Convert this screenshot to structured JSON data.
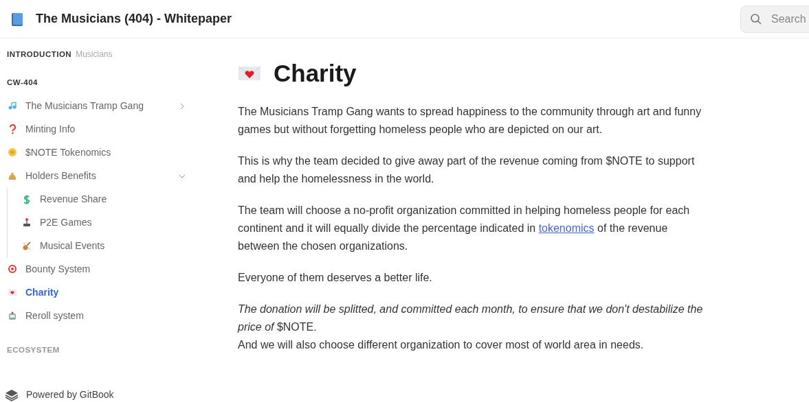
{
  "header": {
    "title": "The Musicians (404) - Whitepaper",
    "search": {
      "placeholder": "Search"
    }
  },
  "sidebar": {
    "sections": [
      {
        "heading": "INTRODUCTION",
        "faded_text": "Musicians"
      },
      {
        "heading": "CW-404",
        "items": [
          {
            "label": "The Musicians Tramp Gang",
            "selected": false,
            "expandable": true,
            "expanded": false
          },
          {
            "label": "Minting Info",
            "selected": false
          },
          {
            "label": "$NOTE Tokenomics",
            "selected": false
          },
          {
            "label": "Holders Benefits",
            "selected": false,
            "expandable": true,
            "expanded": true,
            "children": [
              {
                "label": "Revenue Share",
                "selected": false
              },
              {
                "label": "P2E Games",
                "selected": false
              },
              {
                "label": "Musical Events",
                "selected": false
              }
            ]
          },
          {
            "label": "Bounty System",
            "selected": false
          },
          {
            "label": "Charity",
            "selected": true
          },
          {
            "label": "Reroll system",
            "selected": false
          }
        ]
      },
      {
        "heading": "ECOSYSTEM"
      }
    ],
    "footer": "Powered by GitBook"
  },
  "page": {
    "title": "Charity",
    "blocks": [
      {
        "kind": "text",
        "text": "The Musicians Tramp Gang wants to spread happiness to the community through art and funny games but without forgetting homeless people who are depicted on our art."
      },
      {
        "kind": "text",
        "text": "This is why the team decided to give away part of the revenue coming from $NOTE to support and help the homelessness in the world."
      },
      {
        "kind": "linked",
        "before": "The team will choose a no-profit organization committed in helping homeless people for each continent and it will equally divide the percentage indicated in",
        "link": "tokenomics",
        "after": "of the revenue between the chosen organizations."
      },
      {
        "kind": "text",
        "text": "Everyone of them deserves a better life."
      },
      {
        "kind": "lines",
        "lines": [
          "*The donation will be splitted, and committed each month, to ensure that we don't destabilize the price of* $NOTE.",
          "And we will also choose different organization to cover most of world area in needs."
        ]
      }
    ]
  }
}
